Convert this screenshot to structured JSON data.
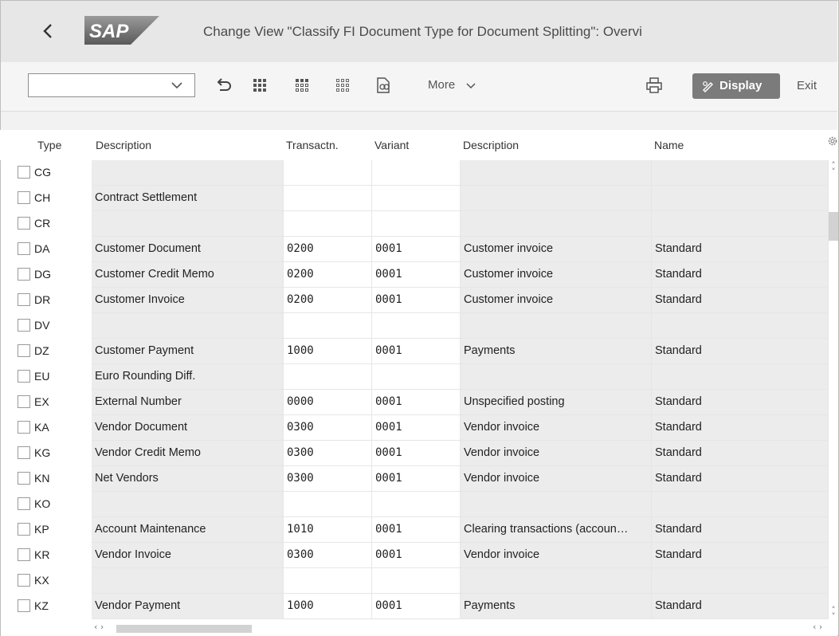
{
  "header": {
    "title": "Change View \"Classify FI Document Type for Document Splitting\": Overvi",
    "logo_text": "SAP"
  },
  "toolbar": {
    "command_value": "",
    "more_label": "More",
    "display_label": "Display",
    "exit_label": "Exit"
  },
  "table": {
    "columns": [
      "Type",
      "Description",
      "Transactn.",
      "Variant",
      "Description",
      "Name"
    ],
    "rows": [
      {
        "type": "CG",
        "desc": "",
        "trans": "",
        "variant": "",
        "desc2": "",
        "name": ""
      },
      {
        "type": "CH",
        "desc": "Contract Settlement",
        "trans": "",
        "variant": "",
        "desc2": "",
        "name": ""
      },
      {
        "type": "CR",
        "desc": "",
        "trans": "",
        "variant": "",
        "desc2": "",
        "name": ""
      },
      {
        "type": "DA",
        "desc": "Customer Document",
        "trans": "0200",
        "variant": "0001",
        "desc2": "Customer invoice",
        "name": "Standard"
      },
      {
        "type": "DG",
        "desc": "Customer Credit Memo",
        "trans": "0200",
        "variant": "0001",
        "desc2": "Customer invoice",
        "name": "Standard"
      },
      {
        "type": "DR",
        "desc": "Customer Invoice",
        "trans": "0200",
        "variant": "0001",
        "desc2": "Customer invoice",
        "name": "Standard"
      },
      {
        "type": "DV",
        "desc": "",
        "trans": "",
        "variant": "",
        "desc2": "",
        "name": ""
      },
      {
        "type": "DZ",
        "desc": "Customer Payment",
        "trans": "1000",
        "variant": "0001",
        "desc2": "Payments",
        "name": "Standard"
      },
      {
        "type": "EU",
        "desc": "Euro Rounding Diff.",
        "trans": "",
        "variant": "",
        "desc2": "",
        "name": ""
      },
      {
        "type": "EX",
        "desc": "External Number",
        "trans": "0000",
        "variant": "0001",
        "desc2": "Unspecified posting",
        "name": "Standard"
      },
      {
        "type": "KA",
        "desc": "Vendor Document",
        "trans": "0300",
        "variant": "0001",
        "desc2": "Vendor invoice",
        "name": "Standard"
      },
      {
        "type": "KG",
        "desc": "Vendor Credit Memo",
        "trans": "0300",
        "variant": "0001",
        "desc2": "Vendor invoice",
        "name": "Standard"
      },
      {
        "type": "KN",
        "desc": "Net Vendors",
        "trans": "0300",
        "variant": "0001",
        "desc2": "Vendor invoice",
        "name": "Standard"
      },
      {
        "type": "KO",
        "desc": "",
        "trans": "",
        "variant": "",
        "desc2": "",
        "name": ""
      },
      {
        "type": "KP",
        "desc": "Account Maintenance",
        "trans": "1010",
        "variant": "0001",
        "desc2": "Clearing transactions (accoun…",
        "name": "Standard"
      },
      {
        "type": "KR",
        "desc": "Vendor Invoice",
        "trans": "0300",
        "variant": "0001",
        "desc2": "Vendor invoice",
        "name": "Standard"
      },
      {
        "type": "KX",
        "desc": "",
        "trans": "",
        "variant": "",
        "desc2": "",
        "name": ""
      },
      {
        "type": "KZ",
        "desc": "Vendor Payment",
        "trans": "1000",
        "variant": "0001",
        "desc2": "Payments",
        "name": "Standard"
      }
    ]
  }
}
